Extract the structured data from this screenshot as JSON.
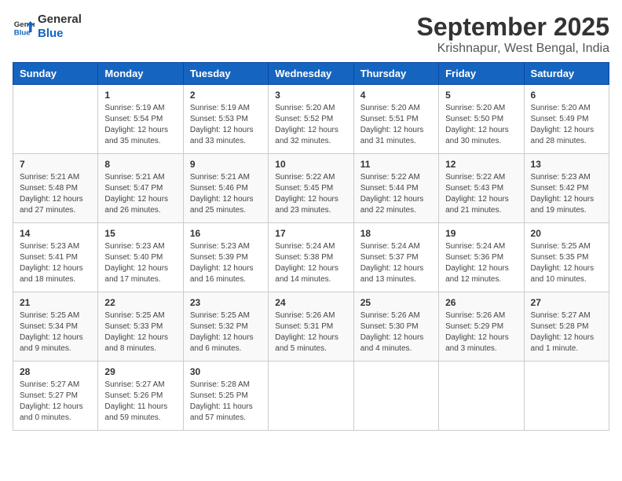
{
  "header": {
    "logo_line1": "General",
    "logo_line2": "Blue",
    "month": "September 2025",
    "location": "Krishnapur, West Bengal, India"
  },
  "weekdays": [
    "Sunday",
    "Monday",
    "Tuesday",
    "Wednesday",
    "Thursday",
    "Friday",
    "Saturday"
  ],
  "weeks": [
    [
      {
        "day": "",
        "text": ""
      },
      {
        "day": "1",
        "text": "Sunrise: 5:19 AM\nSunset: 5:54 PM\nDaylight: 12 hours\nand 35 minutes."
      },
      {
        "day": "2",
        "text": "Sunrise: 5:19 AM\nSunset: 5:53 PM\nDaylight: 12 hours\nand 33 minutes."
      },
      {
        "day": "3",
        "text": "Sunrise: 5:20 AM\nSunset: 5:52 PM\nDaylight: 12 hours\nand 32 minutes."
      },
      {
        "day": "4",
        "text": "Sunrise: 5:20 AM\nSunset: 5:51 PM\nDaylight: 12 hours\nand 31 minutes."
      },
      {
        "day": "5",
        "text": "Sunrise: 5:20 AM\nSunset: 5:50 PM\nDaylight: 12 hours\nand 30 minutes."
      },
      {
        "day": "6",
        "text": "Sunrise: 5:20 AM\nSunset: 5:49 PM\nDaylight: 12 hours\nand 28 minutes."
      }
    ],
    [
      {
        "day": "7",
        "text": "Sunrise: 5:21 AM\nSunset: 5:48 PM\nDaylight: 12 hours\nand 27 minutes."
      },
      {
        "day": "8",
        "text": "Sunrise: 5:21 AM\nSunset: 5:47 PM\nDaylight: 12 hours\nand 26 minutes."
      },
      {
        "day": "9",
        "text": "Sunrise: 5:21 AM\nSunset: 5:46 PM\nDaylight: 12 hours\nand 25 minutes."
      },
      {
        "day": "10",
        "text": "Sunrise: 5:22 AM\nSunset: 5:45 PM\nDaylight: 12 hours\nand 23 minutes."
      },
      {
        "day": "11",
        "text": "Sunrise: 5:22 AM\nSunset: 5:44 PM\nDaylight: 12 hours\nand 22 minutes."
      },
      {
        "day": "12",
        "text": "Sunrise: 5:22 AM\nSunset: 5:43 PM\nDaylight: 12 hours\nand 21 minutes."
      },
      {
        "day": "13",
        "text": "Sunrise: 5:23 AM\nSunset: 5:42 PM\nDaylight: 12 hours\nand 19 minutes."
      }
    ],
    [
      {
        "day": "14",
        "text": "Sunrise: 5:23 AM\nSunset: 5:41 PM\nDaylight: 12 hours\nand 18 minutes."
      },
      {
        "day": "15",
        "text": "Sunrise: 5:23 AM\nSunset: 5:40 PM\nDaylight: 12 hours\nand 17 minutes."
      },
      {
        "day": "16",
        "text": "Sunrise: 5:23 AM\nSunset: 5:39 PM\nDaylight: 12 hours\nand 16 minutes."
      },
      {
        "day": "17",
        "text": "Sunrise: 5:24 AM\nSunset: 5:38 PM\nDaylight: 12 hours\nand 14 minutes."
      },
      {
        "day": "18",
        "text": "Sunrise: 5:24 AM\nSunset: 5:37 PM\nDaylight: 12 hours\nand 13 minutes."
      },
      {
        "day": "19",
        "text": "Sunrise: 5:24 AM\nSunset: 5:36 PM\nDaylight: 12 hours\nand 12 minutes."
      },
      {
        "day": "20",
        "text": "Sunrise: 5:25 AM\nSunset: 5:35 PM\nDaylight: 12 hours\nand 10 minutes."
      }
    ],
    [
      {
        "day": "21",
        "text": "Sunrise: 5:25 AM\nSunset: 5:34 PM\nDaylight: 12 hours\nand 9 minutes."
      },
      {
        "day": "22",
        "text": "Sunrise: 5:25 AM\nSunset: 5:33 PM\nDaylight: 12 hours\nand 8 minutes."
      },
      {
        "day": "23",
        "text": "Sunrise: 5:25 AM\nSunset: 5:32 PM\nDaylight: 12 hours\nand 6 minutes."
      },
      {
        "day": "24",
        "text": "Sunrise: 5:26 AM\nSunset: 5:31 PM\nDaylight: 12 hours\nand 5 minutes."
      },
      {
        "day": "25",
        "text": "Sunrise: 5:26 AM\nSunset: 5:30 PM\nDaylight: 12 hours\nand 4 minutes."
      },
      {
        "day": "26",
        "text": "Sunrise: 5:26 AM\nSunset: 5:29 PM\nDaylight: 12 hours\nand 3 minutes."
      },
      {
        "day": "27",
        "text": "Sunrise: 5:27 AM\nSunset: 5:28 PM\nDaylight: 12 hours\nand 1 minute."
      }
    ],
    [
      {
        "day": "28",
        "text": "Sunrise: 5:27 AM\nSunset: 5:27 PM\nDaylight: 12 hours\nand 0 minutes."
      },
      {
        "day": "29",
        "text": "Sunrise: 5:27 AM\nSunset: 5:26 PM\nDaylight: 11 hours\nand 59 minutes."
      },
      {
        "day": "30",
        "text": "Sunrise: 5:28 AM\nSunset: 5:25 PM\nDaylight: 11 hours\nand 57 minutes."
      },
      {
        "day": "",
        "text": ""
      },
      {
        "day": "",
        "text": ""
      },
      {
        "day": "",
        "text": ""
      },
      {
        "day": "",
        "text": ""
      }
    ]
  ]
}
